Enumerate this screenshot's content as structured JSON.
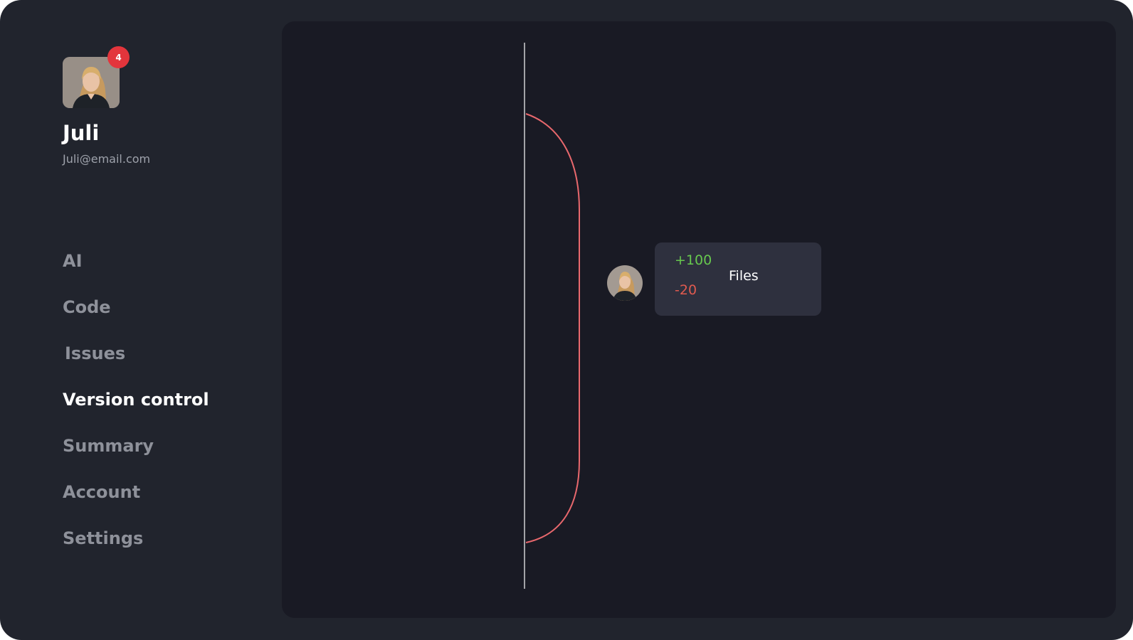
{
  "profile": {
    "name": "Juli",
    "email": "Juli@email.com",
    "notification_count": "4",
    "avatar_icon": "user-portrait-icon"
  },
  "nav": {
    "items": [
      {
        "label": "AI",
        "active": false
      },
      {
        "label": "Code",
        "active": false
      },
      {
        "label": "Issues",
        "active": false
      },
      {
        "label": "Version control",
        "active": true
      },
      {
        "label": "Summary",
        "active": false
      },
      {
        "label": "Account",
        "active": false
      },
      {
        "label": "Settings",
        "active": false
      }
    ]
  },
  "commit": {
    "additions": "+100",
    "deletions": "-20",
    "label": "Files"
  },
  "colors": {
    "background": "#21242d",
    "panel": "#191a24",
    "card": "#2e303e",
    "branch_line": "#e8686d",
    "main_line": "#ffffff",
    "additions": "#67c84e",
    "deletions": "#e05a4f",
    "badge": "#e3353c"
  }
}
